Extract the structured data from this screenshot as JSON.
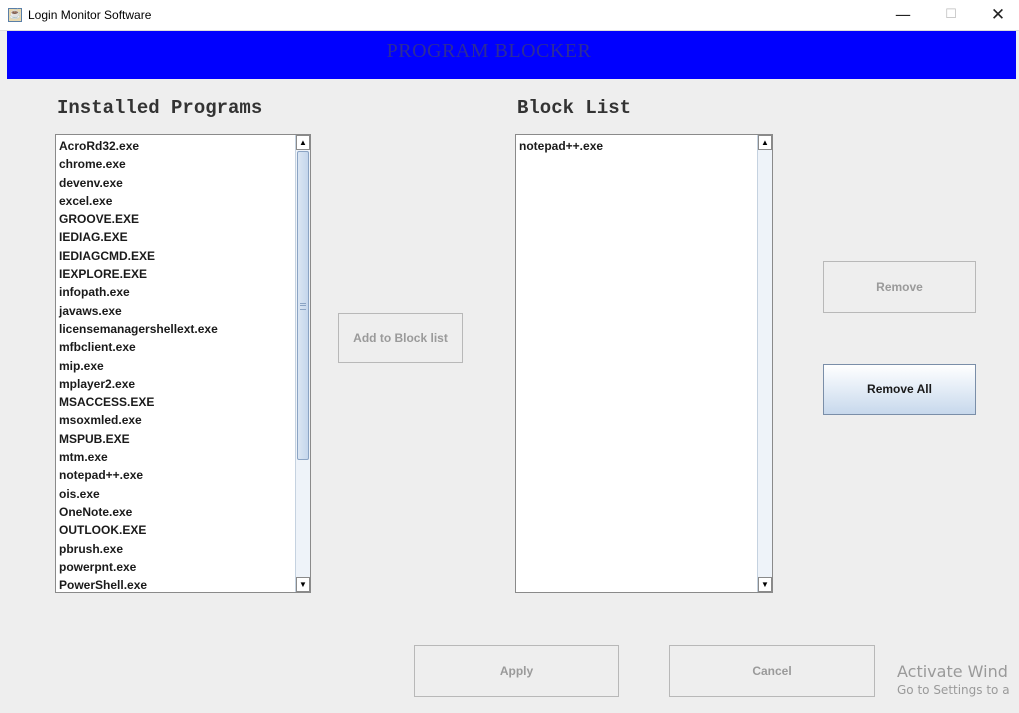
{
  "window": {
    "title": "Login Monitor Software",
    "app_icon": "java-cup-icon",
    "controls": {
      "minimize": "—",
      "maximize": "☐",
      "close": "✕"
    }
  },
  "banner": {
    "title": "PROGRAM  BLOCKER",
    "background": "#0000ff",
    "text_color": "#2c2c9a"
  },
  "installed": {
    "label": "Installed Programs",
    "items": [
      "AcroRd32.exe",
      "chrome.exe",
      "devenv.exe",
      "excel.exe",
      "GROOVE.EXE",
      "IEDIAG.EXE",
      "IEDIAGCMD.EXE",
      "IEXPLORE.EXE",
      "infopath.exe",
      "javaws.exe",
      "licensemanagershellext.exe",
      "mfbclient.exe",
      "mip.exe",
      "mplayer2.exe",
      "MSACCESS.EXE",
      "msoxmled.exe",
      "MSPUB.EXE",
      "mtm.exe",
      "notepad++.exe",
      "ois.exe",
      "OneNote.exe",
      "OUTLOOK.EXE",
      "pbrush.exe",
      "powerpnt.exe",
      "PowerShell.exe"
    ],
    "scroll_position": 0
  },
  "block": {
    "label": "Block List",
    "items": [
      "notepad++.exe"
    ]
  },
  "buttons": {
    "add": "Add to Block list",
    "remove": "Remove",
    "remove_all": "Remove All",
    "apply": "Apply",
    "cancel": "Cancel"
  },
  "watermark": {
    "title": "Activate Wind",
    "subtitle": "Go to Settings to a"
  },
  "colors": {
    "window_bg": "#eeeeee",
    "button_active_gradient_end": "#c7d8ec"
  }
}
